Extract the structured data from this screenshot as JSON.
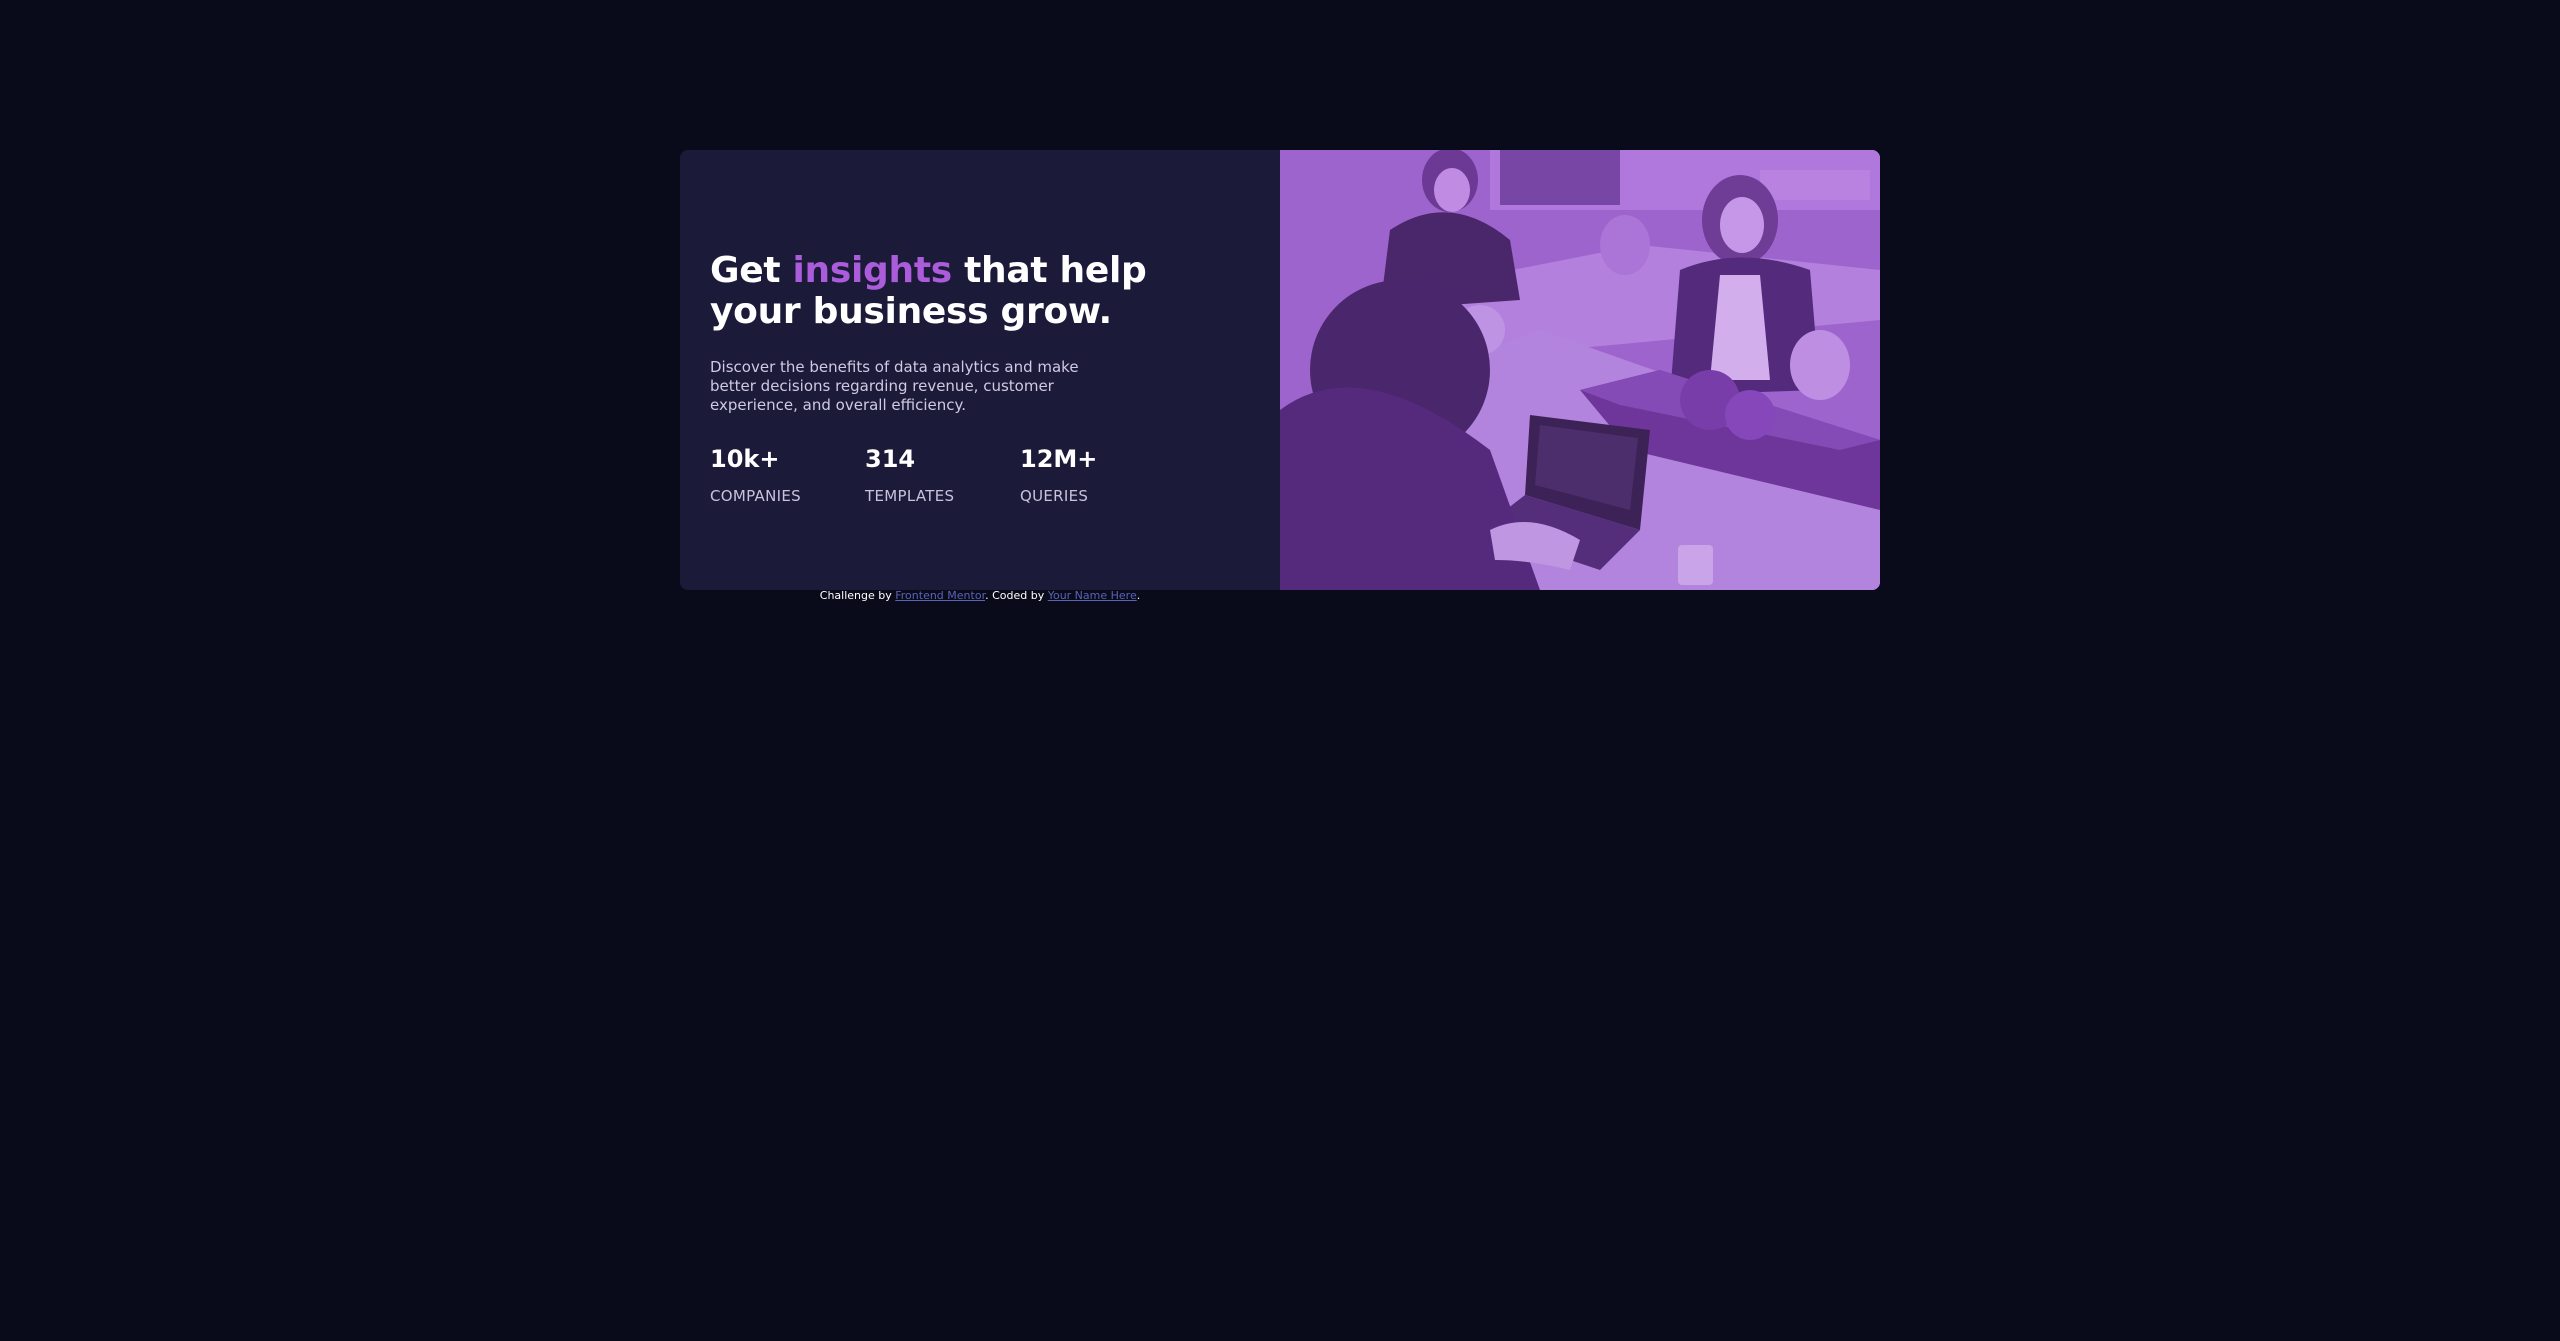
{
  "hero": {
    "headline_before": "Get ",
    "headline_accent": "insights",
    "headline_after": " that help your business grow.",
    "description": "Discover the benefits of data analytics and make better decisions regarding revenue, customer experience, and overall efficiency."
  },
  "stats": [
    {
      "value": "10k+",
      "label": "COMPANIES"
    },
    {
      "value": "314",
      "label": "TEMPLATES"
    },
    {
      "value": "12M+",
      "label": "QUERIES"
    }
  ],
  "image": {
    "overlay_color": "#a56bd3"
  },
  "footer": {
    "prefix": "Challenge by ",
    "link1": "Frontend Mentor",
    "middle": ". Coded by ",
    "link2": "Your Name Here",
    "suffix": "."
  },
  "colors": {
    "background": "#090b1a",
    "card": "#1c1a39",
    "accent": "#ab5cdb",
    "link": "#5a63b8"
  }
}
